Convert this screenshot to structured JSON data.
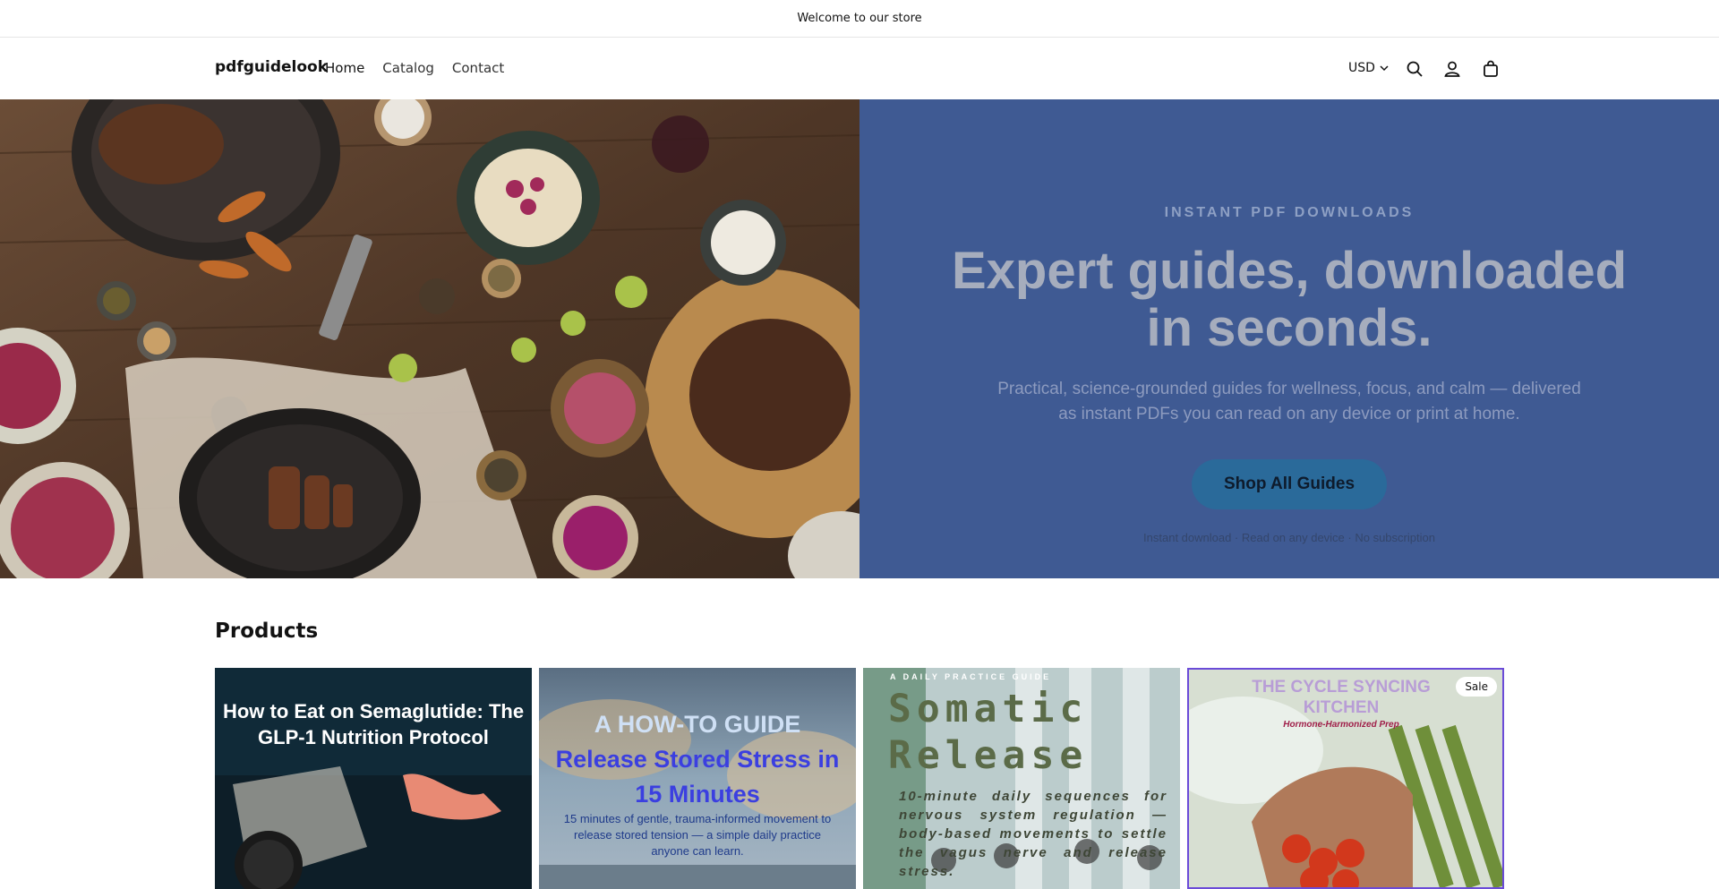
{
  "announcement": "Welcome to our store",
  "header": {
    "logo": "pdfguidelook",
    "nav": [
      "Home",
      "Catalog",
      "Contact"
    ],
    "currency": "USD"
  },
  "hero": {
    "eyebrow": "INSTANT PDF DOWNLOADS",
    "headline": "Expert guides, downloaded in seconds.",
    "subtext": "Practical, science-grounded guides for wellness, focus, and calm — delivered as instant PDFs you can read on any device or print at home.",
    "cta_label": "Shop All Guides",
    "trust_line": "Instant download · Read on any device · No subscription"
  },
  "products": {
    "title": "Products",
    "items": [
      {
        "title": "How to Eat on Semaglutide: The GLP-1 Nutrition Protocol"
      },
      {
        "title_part1": "A HOW-TO GUIDE",
        "title_part2": "Release Stored Stress in 15 Minutes",
        "subtitle": "15 minutes of gentle, trauma-informed movement to release stored tension — a simple daily practice anyone can learn."
      },
      {
        "kicker": "A DAILY PRACTICE GUIDE",
        "title": "Somatic Release",
        "subtitle": "10-minute daily sequences for nervous system regulation — body-based movements to settle the vagus nerve and release stress."
      },
      {
        "title": "THE CYCLE SYNCING KITCHEN",
        "subtitle": "Hormone-Harmonized Prep",
        "badge": "Sale"
      }
    ]
  },
  "colors": {
    "hero_panel": "#3f5a93",
    "cta_bg": "#2a6a9a",
    "card2_title": "#3b3fe0"
  }
}
